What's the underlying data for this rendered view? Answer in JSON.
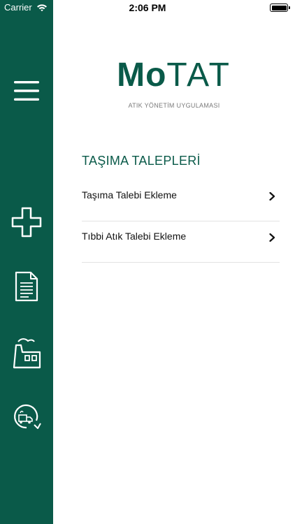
{
  "status_bar": {
    "carrier": "Carrier",
    "time": "2:06 PM"
  },
  "sidebar": {
    "color": "#0a5a49",
    "items": [
      {
        "icon": "hamburger-menu-icon"
      },
      {
        "icon": "plus-icon"
      },
      {
        "icon": "document-icon"
      },
      {
        "icon": "factory-icon"
      },
      {
        "icon": "truck-rotate-icon"
      }
    ]
  },
  "header": {
    "logo_part1": "Mo",
    "logo_part2": "TAT",
    "subtitle": "ATIK YÖNETİM UYGULAMASI"
  },
  "section": {
    "title": "TAŞIMA TALEPLERİ",
    "items": [
      {
        "label": "Taşıma Talebi Ekleme"
      },
      {
        "label": "Tıbbi Atık Talebi Ekleme"
      }
    ]
  },
  "colors": {
    "brand": "#0a5a49",
    "divider": "#e3e3e3"
  }
}
